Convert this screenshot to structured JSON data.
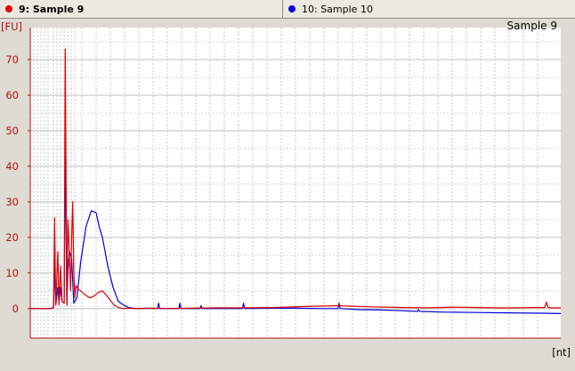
{
  "tabs": [
    {
      "label": "9: Sample 9",
      "color": "#e00000",
      "active": true
    },
    {
      "label": "10: Sample 10",
      "color": "#0000dd",
      "active": false
    }
  ],
  "colors": {
    "red": "#e00000",
    "blue": "#0000dd",
    "axis": "#b01010"
  },
  "chart_data": {
    "type": "line",
    "title": "Sample 9",
    "ylabel": "[FU]",
    "xlabel": "[nt]",
    "ylim": [
      -8.3,
      79
    ],
    "yticks": [
      0,
      10,
      20,
      30,
      40,
      50,
      60,
      70
    ],
    "xlim": [
      0,
      100
    ],
    "grid": true,
    "series": [
      {
        "name": "9: Sample 9",
        "color": "#e00000",
        "x": [
          0,
          4,
          4.4,
          4.6,
          4.8,
          5.2,
          5.4,
          5.7,
          6.0,
          6.4,
          6.6,
          6.9,
          7.1,
          7.2,
          7.6,
          7.8,
          8.0,
          8.2,
          8.4,
          8.6,
          9.0,
          9.5,
          10.2,
          11.2,
          12,
          12.8,
          13.6,
          14.2,
          15.0,
          15.8,
          16.6,
          17.5,
          18.5,
          19.5,
          21,
          23,
          26,
          30,
          35,
          40,
          46,
          52,
          58,
          64,
          70,
          75,
          80,
          84,
          88,
          92,
          95,
          97,
          97.3,
          97.6,
          98,
          100
        ],
        "values": [
          0,
          0,
          0.5,
          25.5,
          1,
          16,
          1,
          12,
          2,
          1.5,
          73,
          1,
          25,
          22,
          5,
          20,
          30,
          10,
          3,
          6.5,
          5.5,
          5,
          4,
          3,
          3.5,
          4.5,
          5,
          4,
          2.5,
          1,
          0.3,
          0,
          0.1,
          0,
          0,
          0.1,
          0,
          0.1,
          0.2,
          0.2,
          0.3,
          0.6,
          0.8,
          0.5,
          0.3,
          0.2,
          0.4,
          0.3,
          0.2,
          0.2,
          0.3,
          0.3,
          1.8,
          0.3,
          0.2,
          0.2
        ]
      },
      {
        "name": "10: Sample 10",
        "color": "#0000dd",
        "x": [
          0,
          4,
          4.4,
          4.6,
          4.8,
          5.2,
          5.4,
          5.7,
          6.0,
          6.4,
          6.6,
          6.9,
          7.1,
          7.4,
          7.8,
          8.2,
          8.8,
          9.5,
          10.5,
          11.5,
          12.4,
          13.0,
          13.6,
          14.6,
          15.6,
          16.6,
          17.6,
          18.5,
          20,
          22,
          24,
          24.2,
          24.4,
          28,
          28.2,
          28.4,
          32,
          32.2,
          32.4,
          36,
          40,
          40.2,
          40.4,
          45,
          50,
          55,
          58,
          58.2,
          58.4,
          62,
          66,
          70,
          73,
          73.2,
          73.4,
          78,
          84,
          90,
          96,
          100
        ],
        "values": [
          0,
          0,
          0.3,
          14,
          1,
          6,
          1.5,
          6,
          2,
          1.5,
          45,
          1,
          11,
          16,
          14,
          1.5,
          3,
          13,
          23,
          27.5,
          27,
          23,
          20,
          12,
          6,
          2,
          1,
          0.3,
          0,
          0.1,
          0,
          1.5,
          0,
          0,
          1.5,
          0,
          0,
          0.8,
          0,
          0,
          0,
          1.5,
          0,
          0.1,
          0.1,
          0,
          0,
          1.5,
          0,
          -0.3,
          -0.4,
          -0.6,
          -0.8,
          -0.3,
          -0.8,
          -1.0,
          -1.1,
          -1.2,
          -1.3,
          -1.4
        ]
      }
    ]
  }
}
